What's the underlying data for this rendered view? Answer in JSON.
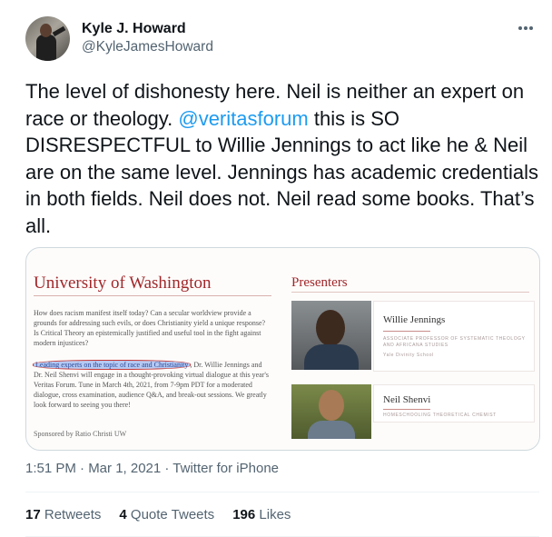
{
  "author": {
    "display_name": "Kyle J. Howard",
    "handle": "@KyleJamesHoward"
  },
  "tweet": {
    "text_before": "The level of dishonesty here. Neil is neither an expert on race or theology. ",
    "mention": "@veritasforum",
    "text_after": " this is SO DISRESPECTFUL to Willie Jennings to act like he & Neil are on the same level. Jennings has academic credentials in both fields. Neil does not. Neil read some books. That’s all."
  },
  "image": {
    "left_title": "University of Washington",
    "body_1": "How does racism manifest itself today? Can a secular worldview provide a grounds for addressing such evils, or does Christianity yield a unique response? Is Critical Theory an epistemically justified and useful tool in the fight against modern injustices?",
    "highlight": "Leading experts on the topic of race and Christianity",
    "body_2": ", Dr. Willie Jennings and Dr. Neil Shenvi will engage in a thought-provoking virtual dialogue at this year's Veritas Forum. Tune in March 4th, 2021, from 7-9pm PDT for a moderated dialogue, cross examination, audience Q&A, and break-out sessions. We greatly look forward to seeing you there!",
    "sponsor": "Sponsored by Ratio Christi UW",
    "presenters_title": "Presenters",
    "presenter_1": {
      "name": "Willie Jennings",
      "role": "Associate Professor of Systematic Theology and Africana Studies",
      "school": "Yale Divinity School"
    },
    "presenter_2": {
      "name": "Neil Shenvi",
      "role": "Homeschooling Theoretical Chemist"
    }
  },
  "meta": {
    "timestamp": "1:51 PM · Mar 1, 2021 · Twitter for iPhone"
  },
  "stats": {
    "retweets_count": "17",
    "retweets_label": "Retweets",
    "quotes_count": "4",
    "quotes_label": "Quote Tweets",
    "likes_count": "196",
    "likes_label": "Likes"
  },
  "colors": {
    "mention": "#1d9bf0",
    "uw_red": "#a1272a",
    "secondary_text": "#536471"
  }
}
